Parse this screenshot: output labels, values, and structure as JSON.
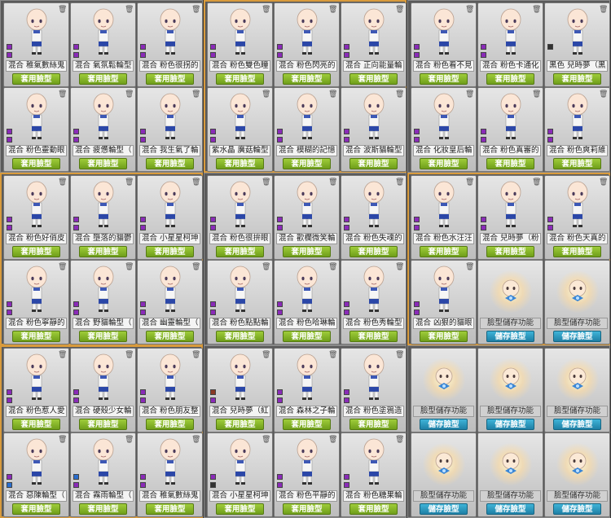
{
  "labels": {
    "apply_button": "套用臉型",
    "save_button": "儲存臉型",
    "storage_slot": "臉型儲存功能",
    "delete_icon": "trash-icon"
  },
  "colors": {
    "purple_swatch": "#8a2bb8",
    "dark_swatch": "#333333",
    "brown_swatch": "#8a3a24",
    "blue_swatch": "#2a6ecf",
    "apply_green": "#7fb02a",
    "save_blue": "#2a95bf",
    "panel_highlight": "#d99b3c"
  },
  "panels": [
    {
      "highlight": false,
      "cards": [
        {
          "name": "混合  稚氣數絲鬼",
          "sw1": "purple",
          "sw2": "purple"
        },
        {
          "name": "混合  氣氛鬆輪型",
          "sw1": "purple",
          "sw2": "purple"
        },
        {
          "name": "混合  粉色很拐的",
          "sw1": "purple",
          "sw2": "purple"
        },
        {
          "name": "混合  粉色靈動眼",
          "sw1": "purple",
          "sw2": "purple"
        },
        {
          "name": "混合  疲憊輪型（",
          "sw1": "purple",
          "sw2": "purple"
        },
        {
          "name": "混合  我生氣了輪",
          "sw1": "purple",
          "sw2": "purple"
        }
      ]
    },
    {
      "highlight": true,
      "cards": [
        {
          "name": "混合  粉色雙色瞳",
          "sw1": "purple",
          "sw2": "purple"
        },
        {
          "name": "混合  粉色閃亮的",
          "sw1": "purple",
          "sw2": "purple"
        },
        {
          "name": "混合  正向能量輪",
          "sw1": "purple",
          "sw2": "purple"
        },
        {
          "name": "紫水晶  廣菇輪型",
          "sw1": "purple",
          "sw2": "purple"
        },
        {
          "name": "混合  模糊的記憶",
          "sw1": "purple",
          "sw2": "purple"
        },
        {
          "name": "混合  波斯貓輪型",
          "sw1": "purple",
          "sw2": "purple"
        }
      ]
    },
    {
      "highlight": false,
      "cards": [
        {
          "name": "混合  粉色看不見",
          "sw1": "purple",
          "sw2": "purple"
        },
        {
          "name": "混合  粉色卡通化",
          "sw1": "purple",
          "sw2": "purple"
        },
        {
          "name": "黑色  兒時夢（黑",
          "sw1": "dark",
          "sw2": ""
        },
        {
          "name": "混合  化妝皇后輪",
          "sw1": "purple",
          "sw2": "purple"
        },
        {
          "name": "混合  粉色真審的",
          "sw1": "purple",
          "sw2": "purple"
        },
        {
          "name": "混合  粉色爽莉維",
          "sw1": "purple",
          "sw2": "purple"
        }
      ]
    },
    {
      "highlight": true,
      "cards": [
        {
          "name": "混合  粉色好俏皮",
          "sw1": "purple",
          "sw2": "purple"
        },
        {
          "name": "混合  墮落的貓鬱",
          "sw1": "purple",
          "sw2": "purple"
        },
        {
          "name": "混合  小星星柯坤",
          "sw1": "purple",
          "sw2": "purple"
        },
        {
          "name": "混合  粉色寧靜的",
          "sw1": "purple",
          "sw2": "purple"
        },
        {
          "name": "混合  野貓輪型（",
          "sw1": "purple",
          "sw2": "purple"
        },
        {
          "name": "混合  幽靈輪型（",
          "sw1": "purple",
          "sw2": "purple"
        }
      ]
    },
    {
      "highlight": false,
      "cards": [
        {
          "name": "混合  粉色很拚眼",
          "sw1": "purple",
          "sw2": "purple"
        },
        {
          "name": "混合  歡欄微笑輪",
          "sw1": "purple",
          "sw2": "purple"
        },
        {
          "name": "混合  粉色失魂的",
          "sw1": "purple",
          "sw2": "purple"
        },
        {
          "name": "混合  粉色點點輪",
          "sw1": "purple",
          "sw2": "purple"
        },
        {
          "name": "混合  粉色哈琳輪",
          "sw1": "purple",
          "sw2": "purple"
        },
        {
          "name": "混合  粉色秀輪型",
          "sw1": "purple",
          "sw2": "purple"
        }
      ]
    },
    {
      "highlight": true,
      "cards": [
        {
          "name": "混合  粉色水汪汪",
          "sw1": "purple",
          "sw2": "purple",
          "type": "face"
        },
        {
          "name": "混合  兒時夢（粉",
          "sw1": "purple",
          "sw2": "purple",
          "type": "face"
        },
        {
          "name": "混合  粉色天真的",
          "sw1": "purple",
          "sw2": "purple",
          "type": "face"
        },
        {
          "name": "混合  凶狠的貓眼",
          "sw1": "purple",
          "sw2": "purple",
          "type": "face"
        },
        {
          "type": "storage"
        },
        {
          "type": "storage"
        }
      ]
    },
    {
      "highlight": true,
      "cards": [
        {
          "name": "混合  粉色惹人愛",
          "sw1": "purple",
          "sw2": "purple"
        },
        {
          "name": "混合  硬殼少女輪",
          "sw1": "purple",
          "sw2": "purple"
        },
        {
          "name": "混合  粉色朋友整",
          "sw1": "purple",
          "sw2": "purple"
        },
        {
          "name": "混合  惡陳輪型（",
          "sw1": "purple",
          "sw2": "blue"
        },
        {
          "name": "混合  霧雨輪型（",
          "sw1": "blue",
          "sw2": "purple"
        },
        {
          "name": "混合  稚氣數絲鬼",
          "sw1": "purple",
          "sw2": "purple"
        }
      ]
    },
    {
      "highlight": false,
      "cards": [
        {
          "name": "混合  兒時夢（紅",
          "sw1": "brown",
          "sw2": "purple"
        },
        {
          "name": "混合  森林之子輪",
          "sw1": "purple",
          "sw2": "purple"
        },
        {
          "name": "混合  粉色塗鴉造",
          "sw1": "purple",
          "sw2": "purple"
        },
        {
          "name": "混合  小星星柯坤",
          "sw1": "purple",
          "sw2": "dark"
        },
        {
          "name": "混合  粉色平靜的",
          "sw1": "purple",
          "sw2": "purple"
        },
        {
          "name": "混合  粉色糖果輪",
          "sw1": "purple",
          "sw2": "purple"
        }
      ]
    },
    {
      "highlight": false,
      "cards": [
        {
          "type": "storage"
        },
        {
          "type": "storage"
        },
        {
          "type": "storage"
        },
        {
          "type": "storage"
        },
        {
          "type": "storage"
        },
        {
          "type": "storage"
        }
      ]
    }
  ]
}
